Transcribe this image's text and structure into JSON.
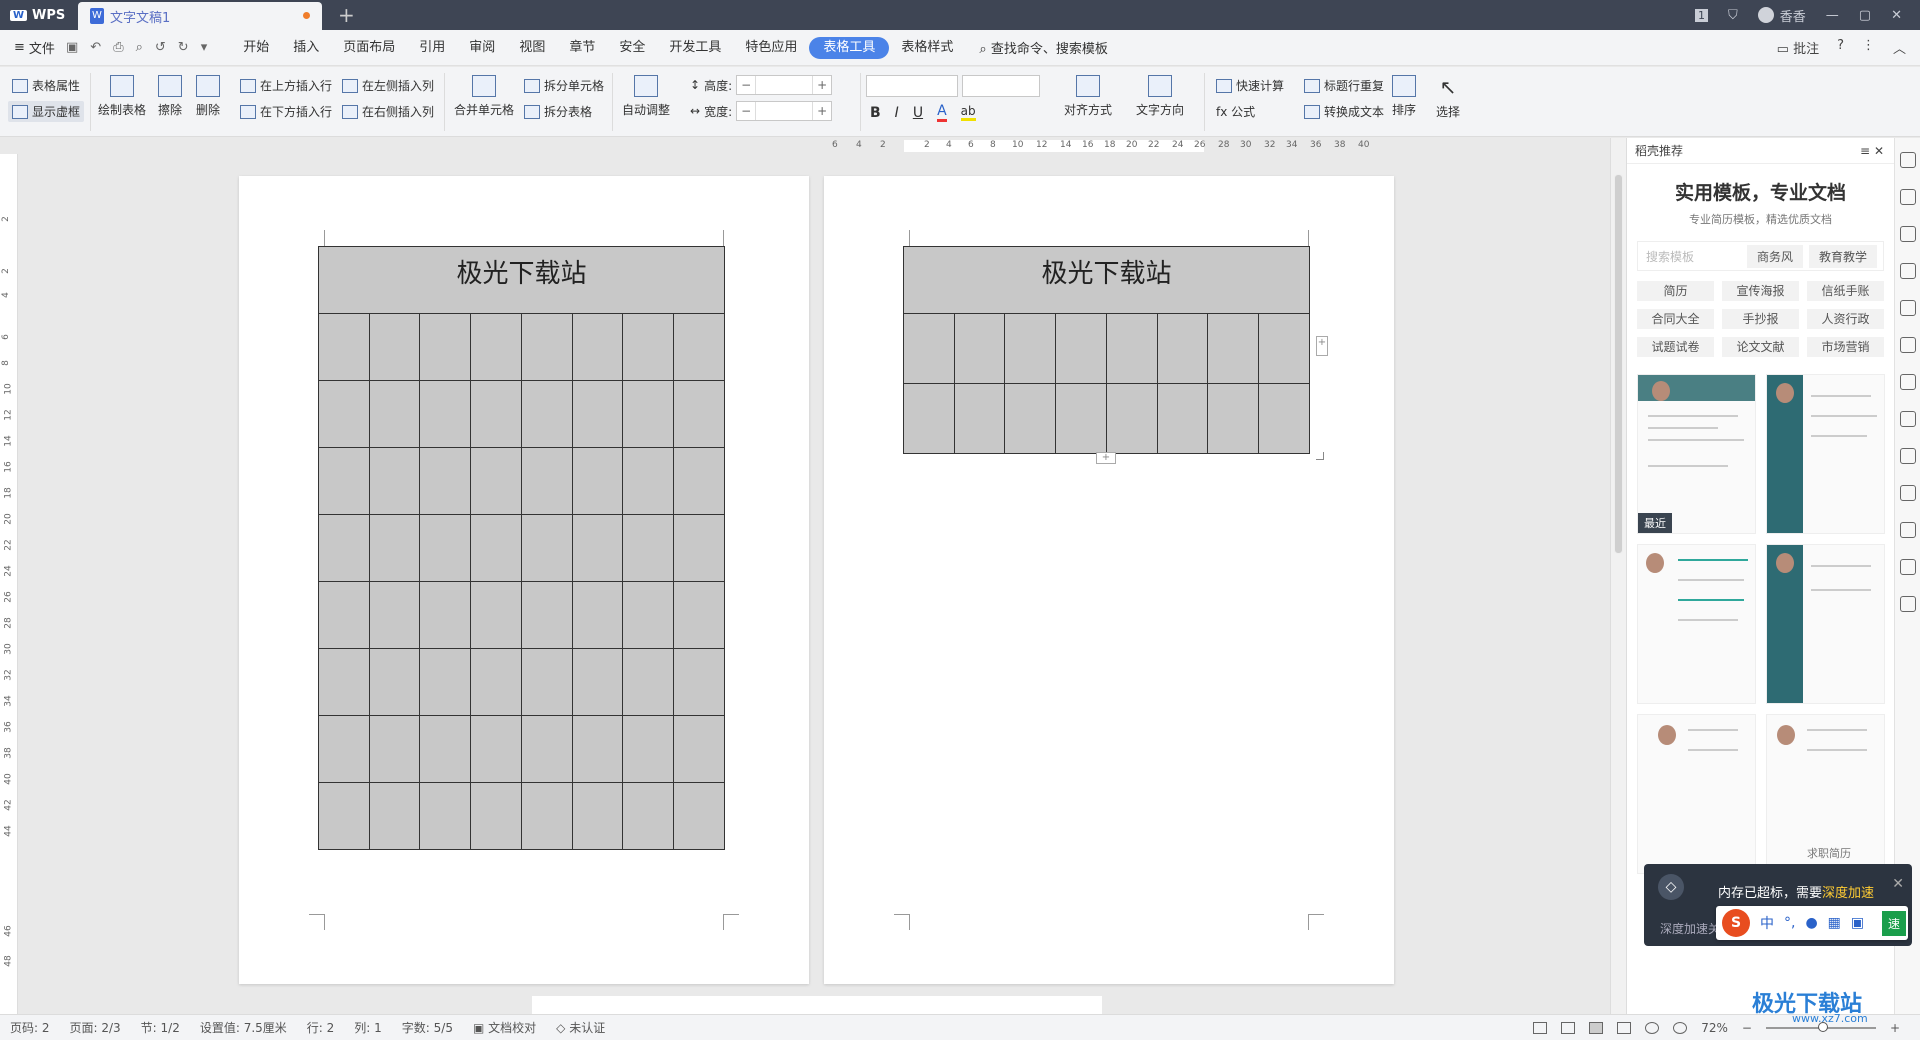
{
  "titlebar": {
    "app_name": "WPS",
    "app_logo": "W",
    "doc_tab": "文字文稿1",
    "doc_icon": "W",
    "new_tab": "+",
    "page_badge": "1",
    "user_name": "香香",
    "window_controls": [
      "—",
      "▢",
      "✕"
    ],
    "icons": [
      "shirt-icon"
    ]
  },
  "menubar": {
    "file_label": "文件",
    "quick_access": [
      "save-icon",
      "undo-history-icon",
      "print-icon",
      "preview-icon",
      "undo-icon",
      "redo-icon",
      "more-icon"
    ],
    "items": [
      "开始",
      "插入",
      "页面布局",
      "引用",
      "审阅",
      "视图",
      "章节",
      "安全",
      "开发工具",
      "特色应用",
      "表格工具",
      "表格样式"
    ],
    "active_item": "表格工具",
    "search_label": "查找命令、搜索模板",
    "right_comment": "批注",
    "help": "?",
    "more": "⋮",
    "collapse": "︿"
  },
  "ribbon": {
    "table_props": "表格属性",
    "show_grid": "显示虚框",
    "draw_table": "绘制表格",
    "erase": "擦除",
    "delete": "删除",
    "insert_above": "在上方插入行",
    "insert_below": "在下方插入行",
    "insert_left": "在左侧插入列",
    "insert_right": "在右侧插入列",
    "merge_cells": "合并单元格",
    "split_cells": "拆分单元格",
    "split_table": "拆分表格",
    "auto_fit": "自动调整",
    "height_label": "高度:",
    "width_label": "宽度:",
    "bold": "B",
    "italic": "I",
    "underline": "U",
    "font_color": "A",
    "highlight": "ab",
    "align": "对齐方式",
    "text_dir": "文字方向",
    "quick_calc": "快速计算",
    "formula": "fx 公式",
    "repeat_header": "标题行重复",
    "to_text": "转换成文本",
    "sort": "排序",
    "select": "选择"
  },
  "ruler": {
    "top_numbers": [
      "6",
      "4",
      "2",
      "2",
      "4",
      "6",
      "8",
      "10",
      "12",
      "14",
      "16",
      "18",
      "20",
      "22",
      "24",
      "26",
      "28",
      "30",
      "32",
      "34",
      "36",
      "38",
      "40"
    ],
    "left_numbers": [
      "2",
      "2",
      "4",
      "6",
      "8",
      "10",
      "12",
      "14",
      "16",
      "18",
      "20",
      "22",
      "24",
      "26",
      "28",
      "30",
      "32",
      "34",
      "36",
      "38",
      "40",
      "42",
      "44",
      "46",
      "48"
    ]
  },
  "document": {
    "page1_title": "极光下载站",
    "page2_title": "极光下载站",
    "page1_columns": 8,
    "page1_data_rows": 8,
    "page2_columns": 8,
    "page2_data_rows": 2,
    "table_fill": "#c8c8c8",
    "add_button": "+"
  },
  "panel": {
    "header": "稻壳推荐",
    "headline": "实用模板，专业文档",
    "subline": "专业简历模板，精选优质文档",
    "search_placeholder": "搜索模板",
    "search_tags": [
      "商务风",
      "教育教学"
    ],
    "categories": [
      "简历",
      "宣传海报",
      "信纸手账",
      "合同大全",
      "手抄报",
      "人资行政",
      "试题试卷",
      "论文文献",
      "市场营销"
    ],
    "recent_label": "最近",
    "thumb_caption": "求职简历"
  },
  "toast": {
    "message": "内存已超标，需要",
    "action": "深度加速",
    "footer": "深度加速关闭",
    "close": "✕"
  },
  "ime": {
    "logo": "S",
    "lang": "中",
    "punct": "°,",
    "speed_label": "速"
  },
  "statusbar": {
    "page_code": "页码: 2",
    "page": "页面: 2/3",
    "section": "节: 1/2",
    "setting": "设置值: 7.5厘米",
    "row": "行: 2",
    "col": "列: 1",
    "words": "字数: 5/5",
    "proof": "文档校对",
    "cert": "未认证",
    "zoom": "72%",
    "zoom_level": 0.72
  },
  "watermark": {
    "text": "极光下载站",
    "url": "www.xz7.com"
  }
}
